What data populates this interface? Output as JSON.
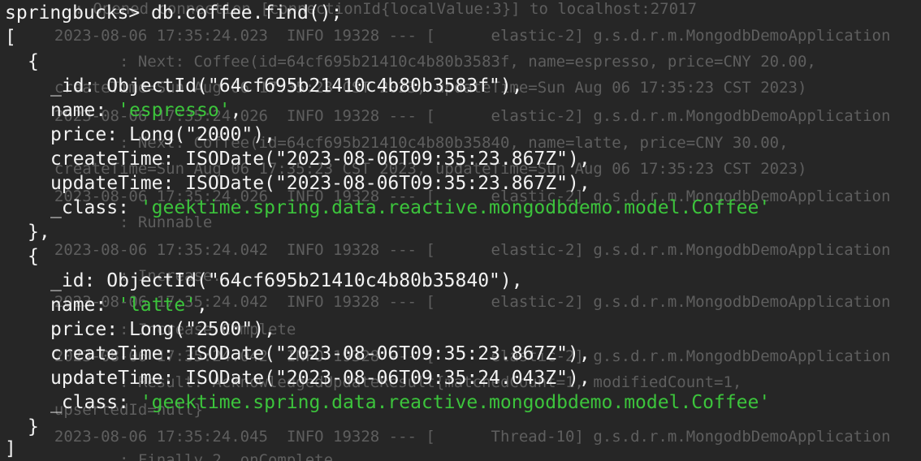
{
  "prompt": "springbucks> db.coffee.find();",
  "docs": [
    {
      "_id": "ObjectId(\"64cf695b21410c4b80b3583f\"),",
      "name": "'espresso'",
      "price": "Long(\"2000\"),",
      "createTime": "ISODate(\"2023-08-06T09:35:23.867Z\"),",
      "updateTime": "ISODate(\"2023-08-06T09:35:23.867Z\"),",
      "class": "'geektime.spring.data.reactive.mongodbdemo.model.Coffee'"
    },
    {
      "_id": "ObjectId(\"64cf695b21410c4b80b35840\"),",
      "name": "'latte'",
      "price": "Long(\"2500\"),",
      "createTime": "ISODate(\"2023-08-06T09:35:23.867Z\"),",
      "updateTime": "ISODate(\"2023-08-06T09:35:24.043Z\"),",
      "class": "'geektime.spring.data.reactive.mongodbdemo.model.Coffee'"
    }
  ],
  "syntax": {
    "open_bracket": "[",
    "close_bracket": "]",
    "open_brace": "{",
    "close_brace_comma": "},",
    "close_brace": "}",
    "comma": ",",
    "key_id": "_id: ",
    "key_name": "name: ",
    "key_price": "price: ",
    "key_create": "createTime: ",
    "key_update": "updateTime: ",
    "key_class": "_class: "
  },
  "background_log": [
    "        : Opened connection [connectionId{localValue:3}] to localhost:27017",
    "  2023-08-06 17:35:24.023  INFO 19328 --- [      elastic-2] g.s.d.r.m.MongodbDemoApplication",
    "         : Next: Coffee(id=64cf695b21410c4b80b3583f, name=espresso, price=CNY 20.00,",
    "  createTime=Sun Aug 06 17:35:23 CST 2023, updateTime=Sun Aug 06 17:35:23 CST 2023)",
    "  2023-08-06 17:35:24.026  INFO 19328 --- [      elastic-2] g.s.d.r.m.MongodbDemoApplication",
    "         : Next: Coffee(id=64cf695b21410c4b80b35840, name=latte, price=CNY 30.00,",
    "  createTime=Sun Aug 06 17:35:23 CST 2023, updateTime=Sun Aug 06 17:35:23 CST 2023)",
    "  2023-08-06 17:35:24.026  INFO 19328 --- [      elastic-2] g.s.d.r.m.MongodbDemoApplication",
    "         : Runnable",
    "  2023-08-06 17:35:24.042  INFO 19328 --- [      elastic-2] g.s.d.r.m.MongodbDemoApplication",
    "         : Increase...",
    "  2023-08-06 17:35:24.042  INFO 19328 --- [      elastic-2] g.s.d.r.m.MongodbDemoApplication",
    "         : Increase Complete",
    "  2023-08-06 17:35:24.042  INFO 19328 --- [      elastic-2] g.s.d.r.m.MongodbDemoApplication",
    "         : Result: AcknowledgedUpdateResult{matchedCount=1, modifiedCount=1,",
    "  upsertedId=null}",
    "  2023-08-06 17:35:24.045  INFO 19328 --- [      Thread-10] g.s.d.r.m.MongodbDemoApplication",
    "         : Finally 2, onComplete"
  ]
}
